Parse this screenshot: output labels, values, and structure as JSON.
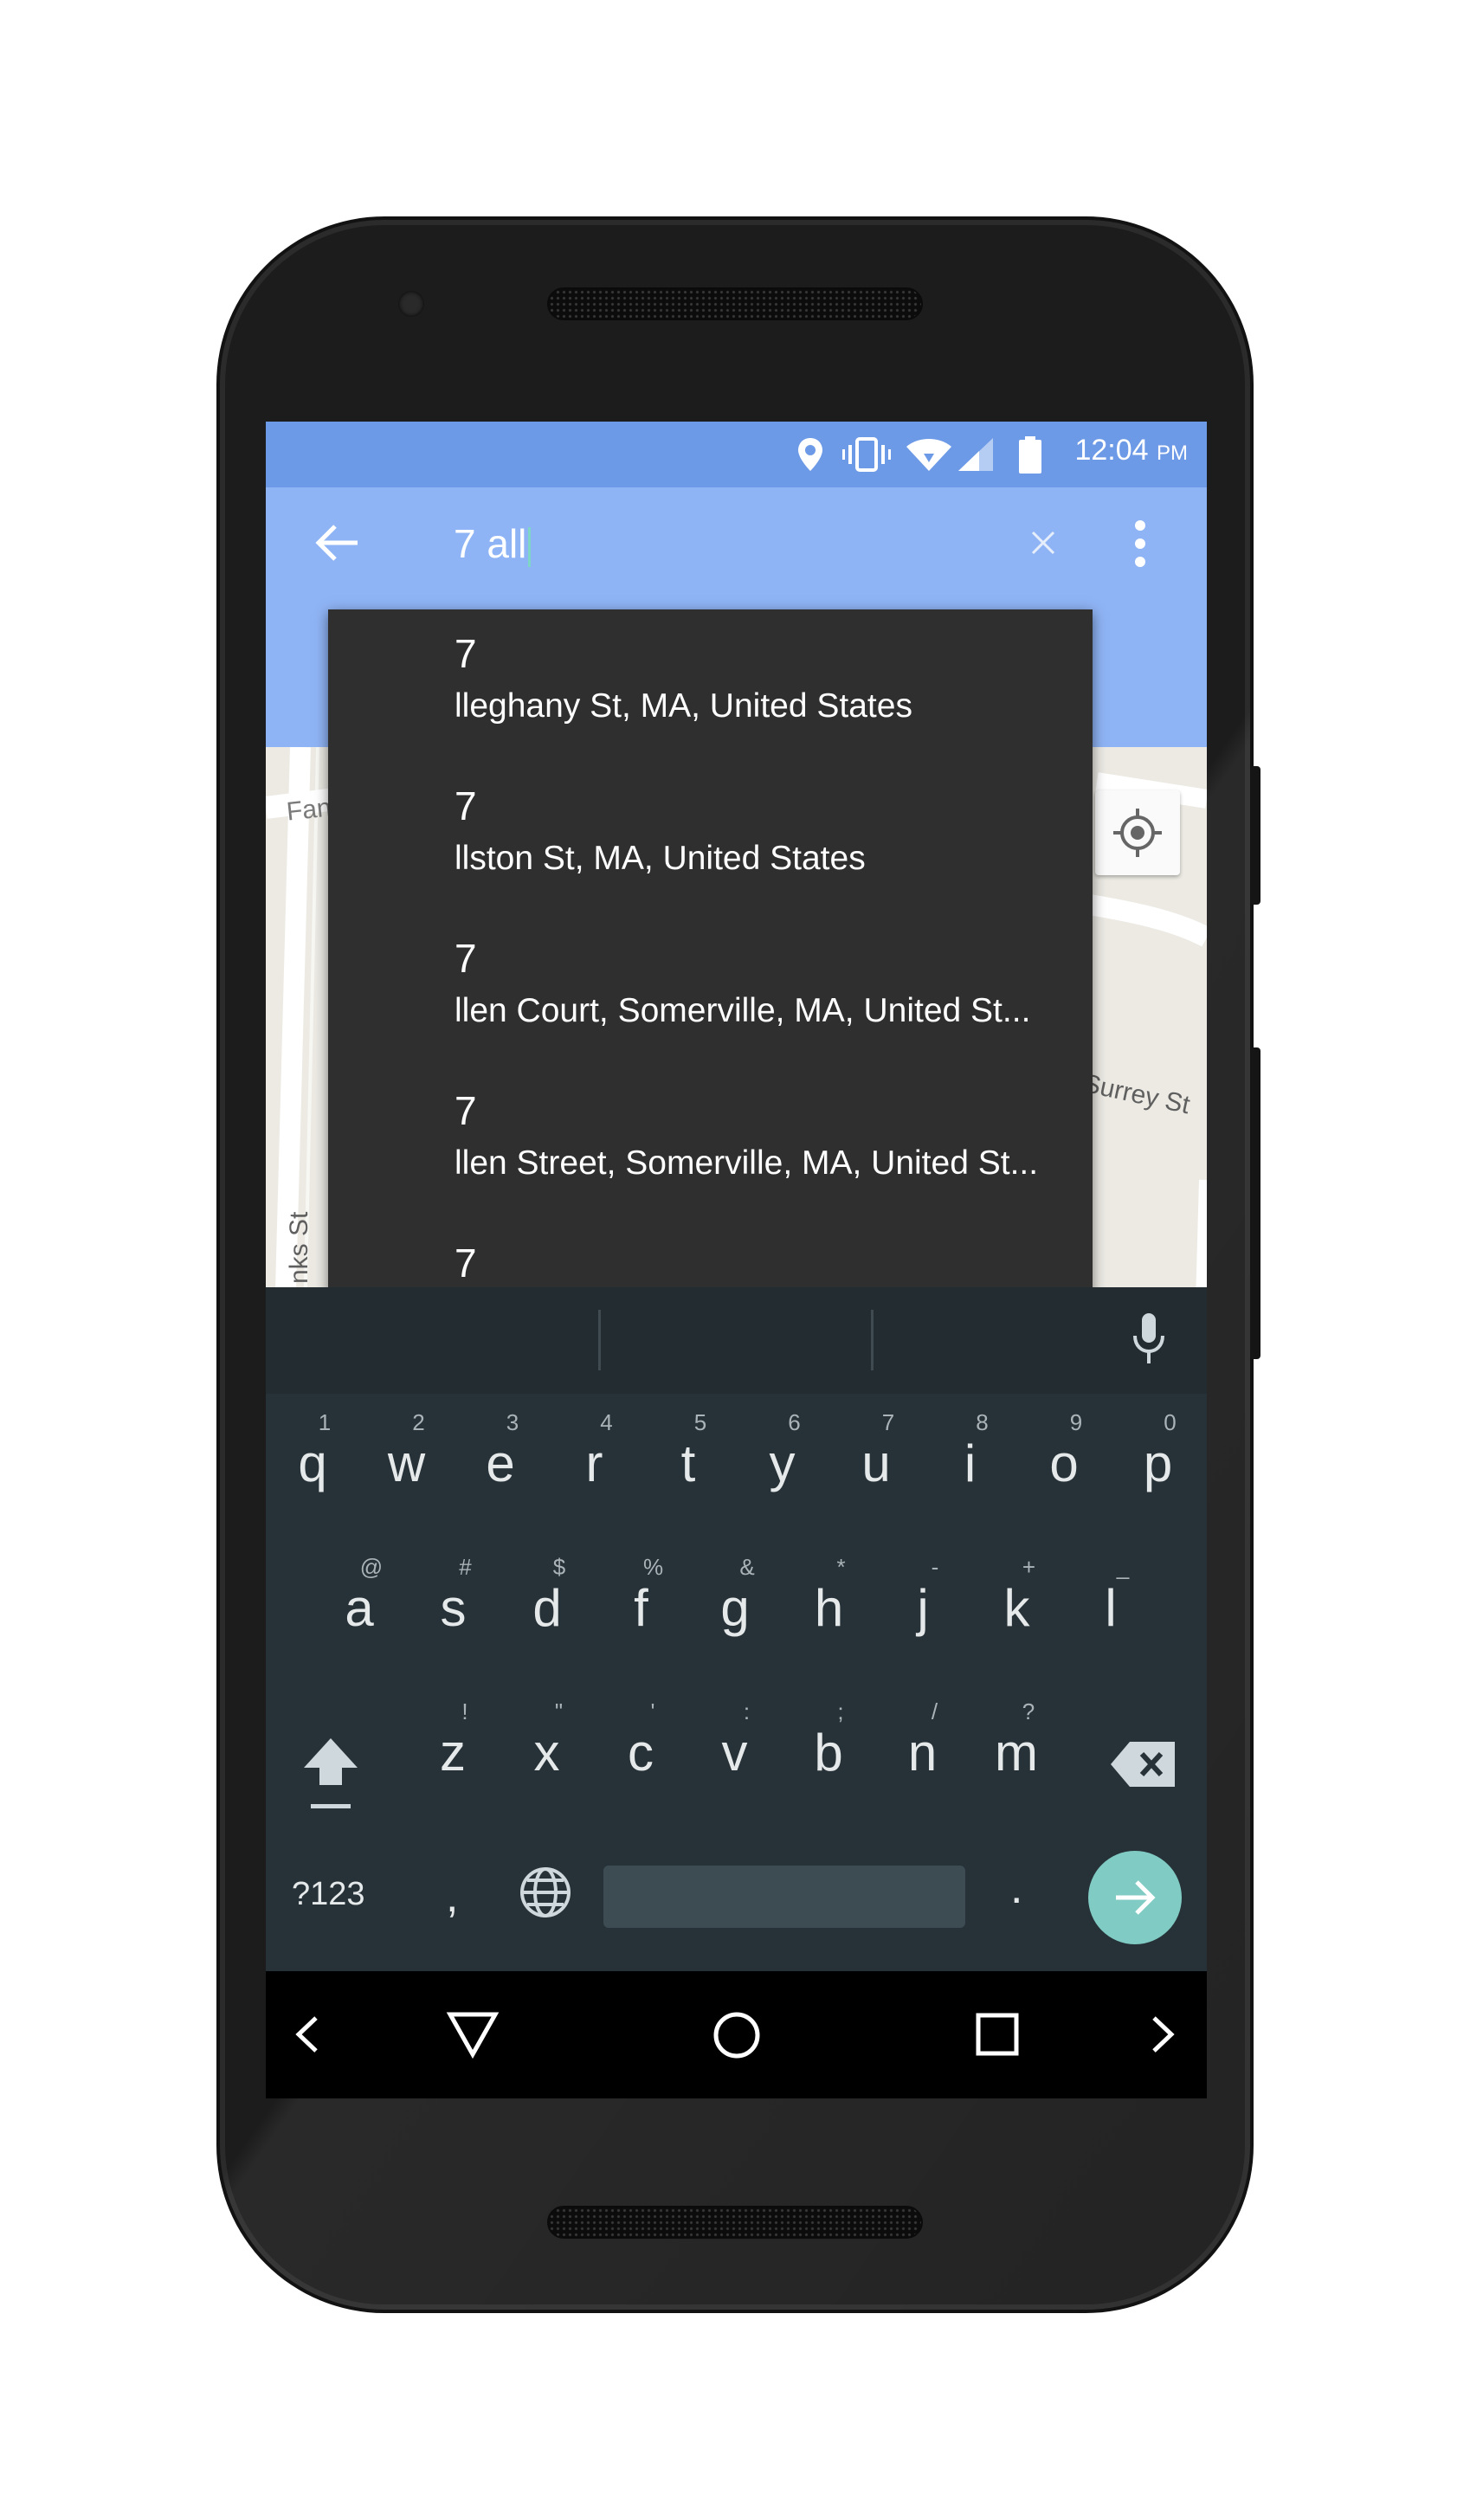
{
  "status_bar": {
    "time": "12:04",
    "ampm": "PM"
  },
  "search": {
    "query": "7 all"
  },
  "map_labels": {
    "label_fan": "Fan",
    "label_surrey": "Surrey St",
    "label_nks": "nks St"
  },
  "suggestions": [
    {
      "number": "7",
      "address": "lleghany St, MA, United States"
    },
    {
      "number": "7",
      "address": "llston St, MA, United States"
    },
    {
      "number": "7",
      "address": "llen Court, Somerville, MA, United St..."
    },
    {
      "number": "7",
      "address": "llen Street, Somerville, MA, United St..."
    },
    {
      "number": "7",
      "address": ""
    }
  ],
  "keyboard": {
    "row1": [
      "q",
      "w",
      "e",
      "r",
      "t",
      "y",
      "u",
      "i",
      "o",
      "p"
    ],
    "row1_hints": [
      "1",
      "2",
      "3",
      "4",
      "5",
      "6",
      "7",
      "8",
      "9",
      "0"
    ],
    "row2": [
      "a",
      "s",
      "d",
      "f",
      "g",
      "h",
      "j",
      "k",
      "l"
    ],
    "row2_hints": [
      "@",
      "#",
      "$",
      "%",
      "&",
      "*",
      "-",
      "+",
      "_"
    ],
    "row3": [
      "z",
      "x",
      "c",
      "v",
      "b",
      "n",
      "m"
    ],
    "row3_hints": [
      "!",
      "\"",
      "'",
      ":",
      ";",
      "/",
      "?"
    ],
    "symbols_label": "?123",
    "comma": ",",
    "period": ".",
    "enter_color": "#80cbc4"
  },
  "colors": {
    "status_bar": "#6d9ae6",
    "app_bar": "#8fb4f5",
    "keyboard_bg": "#263238",
    "suggestion_bg": "#2f2f2f"
  }
}
